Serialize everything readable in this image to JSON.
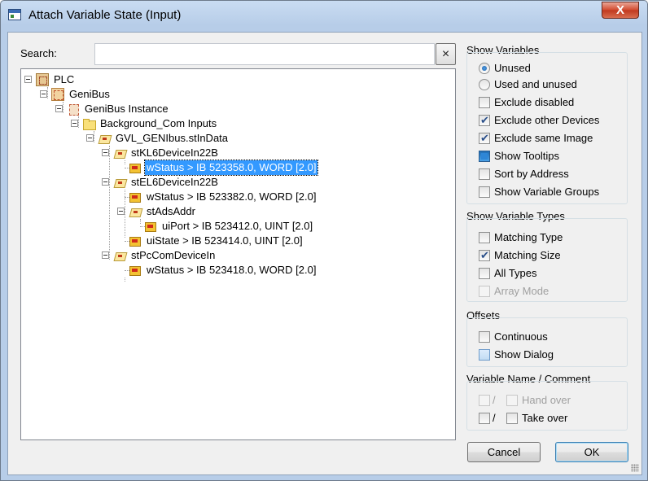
{
  "window": {
    "title": "Attach Variable State (Input)",
    "close_glyph": "X"
  },
  "search": {
    "label": "Search:",
    "value": "",
    "placeholder": "",
    "clear_glyph": "×"
  },
  "tree": {
    "nodes": [
      {
        "label": "PLC",
        "icon": "plc-icon",
        "expanded": true
      },
      {
        "label": "GeniBus",
        "icon": "bus-icon",
        "expanded": true
      },
      {
        "label": "GeniBus Instance",
        "icon": "instance-icon",
        "expanded": true
      },
      {
        "label": "Background_Com Inputs",
        "icon": "folder-icon",
        "expanded": true
      },
      {
        "label": "GVL_GENIbus.stInData",
        "icon": "struct-icon",
        "expanded": true
      },
      {
        "label": "stKL6DeviceIn22B",
        "icon": "struct-icon",
        "expanded": true
      },
      {
        "label": "wStatus    >    IB 523358.0, WORD [2.0]",
        "icon": "variable-icon",
        "selected": true
      },
      {
        "label": "stEL6DeviceIn22B",
        "icon": "struct-icon",
        "expanded": true
      },
      {
        "label": "wStatus    >    IB 523382.0, WORD [2.0]",
        "icon": "variable-icon"
      },
      {
        "label": "stAdsAddr",
        "icon": "struct-icon",
        "expanded": true
      },
      {
        "label": "uiPort    >    IB 523412.0, UINT [2.0]",
        "icon": "variable-icon"
      },
      {
        "label": "uiState    >    IB 523414.0, UINT [2.0]",
        "icon": "variable-icon"
      },
      {
        "label": "stPcComDeviceIn",
        "icon": "struct-icon",
        "expanded": true
      },
      {
        "label": "wStatus    >    IB 523418.0, WORD [2.0]",
        "icon": "variable-icon"
      }
    ]
  },
  "show_variables": {
    "title": "Show Variables",
    "unused": "Unused",
    "used_and_unused": "Used and unused",
    "exclude_disabled": "Exclude disabled",
    "exclude_other_devices": "Exclude other Devices",
    "exclude_same_image": "Exclude same Image",
    "show_tooltips": "Show Tooltips",
    "sort_by_address": "Sort by Address",
    "show_variable_groups": "Show Variable Groups",
    "selected_radio": "Unused",
    "checked": [
      "Exclude other Devices",
      "Exclude same Image"
    ]
  },
  "show_variable_types": {
    "title": "Show Variable Types",
    "matching_type": "Matching Type",
    "matching_size": "Matching Size",
    "all_types": "All Types",
    "array_mode": "Array Mode",
    "checked": [
      "Matching Size"
    ]
  },
  "offsets": {
    "title": "Offsets",
    "continuous": "Continuous",
    "show_dialog": "Show Dialog"
  },
  "variable_name_comment": {
    "title": "Variable Name / Comment",
    "separator": "/",
    "hand_over": "Hand over",
    "take_over": "Take over"
  },
  "buttons": {
    "cancel": "Cancel",
    "ok": "OK"
  }
}
